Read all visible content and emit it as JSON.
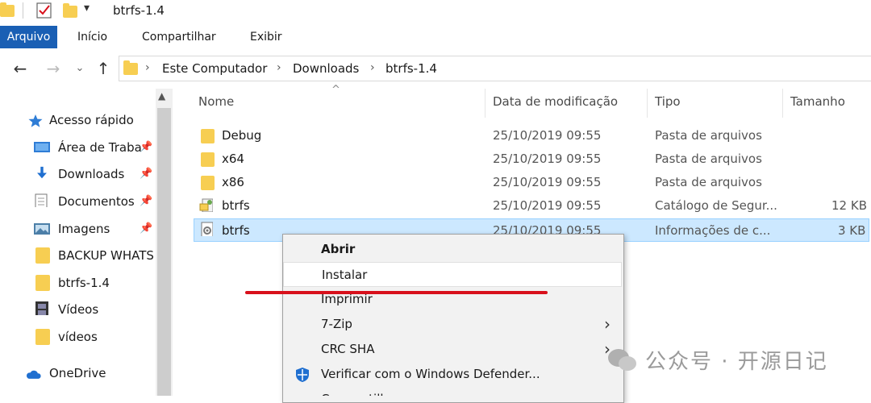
{
  "window": {
    "title": "btrfs-1.4"
  },
  "ribbon": {
    "tabs": [
      "Arquivo",
      "Início",
      "Compartilhar",
      "Exibir"
    ]
  },
  "address": {
    "items": [
      "Este Computador",
      "Downloads",
      "btrfs-1.4"
    ]
  },
  "nav": {
    "items": [
      {
        "label": "Acesso rápido",
        "icon": "star-icon"
      },
      {
        "label": "Área de Traba",
        "icon": "desktop-icon",
        "pinned": true
      },
      {
        "label": "Downloads",
        "icon": "download-icon",
        "pinned": true
      },
      {
        "label": "Documentos",
        "icon": "document-icon",
        "pinned": true
      },
      {
        "label": "Imagens",
        "icon": "images-icon",
        "pinned": true
      },
      {
        "label": "BACKUP WHATS",
        "icon": "folder-icon"
      },
      {
        "label": "btrfs-1.4",
        "icon": "folder-icon"
      },
      {
        "label": "Vídeos",
        "icon": "video-icon"
      },
      {
        "label": "vídeos",
        "icon": "folder-icon"
      },
      {
        "label": "OneDrive",
        "icon": "cloud-icon"
      }
    ]
  },
  "columns": {
    "name": "Nome",
    "modified": "Data de modificação",
    "type": "Tipo",
    "size": "Tamanho"
  },
  "files": [
    {
      "name": "Debug",
      "modified": "25/10/2019 09:55",
      "type": "Pasta de arquivos",
      "size": "",
      "icon": "folder-icon"
    },
    {
      "name": "x64",
      "modified": "25/10/2019 09:55",
      "type": "Pasta de arquivos",
      "size": "",
      "icon": "folder-icon"
    },
    {
      "name": "x86",
      "modified": "25/10/2019 09:55",
      "type": "Pasta de arquivos",
      "size": "",
      "icon": "folder-icon"
    },
    {
      "name": "btrfs",
      "modified": "25/10/2019 09:55",
      "type": "Catálogo de Segur...",
      "size": "12 KB",
      "icon": "catalog-icon"
    },
    {
      "name": "btrfs",
      "modified": "25/10/2019 09:55",
      "type": "Informações de c...",
      "size": "3 KB",
      "icon": "setup-info-icon",
      "selected": true
    }
  ],
  "context_menu": {
    "items": [
      {
        "label": "Abrir",
        "bold": true
      },
      {
        "label": "Instalar",
        "hover": true
      },
      {
        "label": "Imprimir"
      },
      {
        "label": "7-Zip",
        "submenu": true
      },
      {
        "label": "CRC SHA",
        "submenu": true
      },
      {
        "label": "Verificar com o Windows Defender...",
        "icon": "defender-icon"
      },
      {
        "label": "Compartilhar"
      }
    ]
  },
  "watermark": {
    "text": "公众号 · 开源日记"
  },
  "colors": {
    "accent": "#1a5fb4",
    "selection": "#cce8ff",
    "folder": "#f7ce52",
    "annotation": "#d8101b"
  }
}
